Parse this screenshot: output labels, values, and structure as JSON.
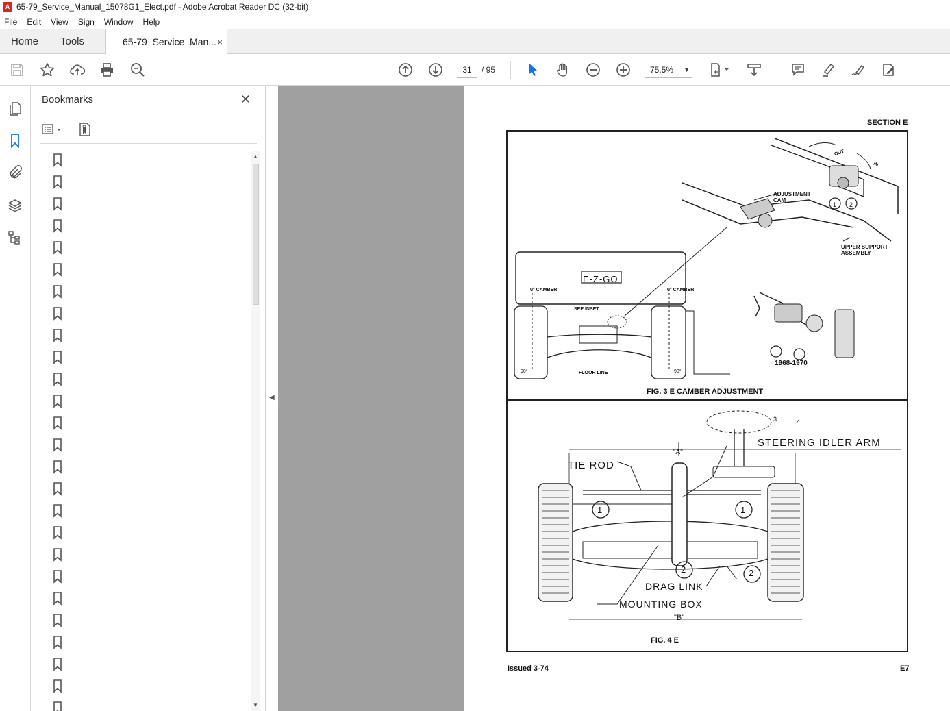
{
  "window": {
    "title": "65-79_Service_Manual_15078G1_Elect.pdf - Adobe Acrobat Reader DC (32-bit)"
  },
  "menu": [
    "File",
    "Edit",
    "View",
    "Sign",
    "Window",
    "Help"
  ],
  "tabs": {
    "home": "Home",
    "tools": "Tools",
    "document": "65-79_Service_Man...",
    "close": "×"
  },
  "toolbar": {
    "page_current": "31",
    "page_total": "/ 95",
    "zoom": "75.5%",
    "icons": [
      "save-icon",
      "star-icon",
      "upload-icon",
      "print-icon",
      "zoom-search-icon",
      "prev-page-icon",
      "next-page-icon",
      "select-cursor-icon",
      "hand-icon",
      "zoom-out-icon",
      "zoom-in-icon",
      "fit-page-icon",
      "scroll-mode-icon",
      "comment-icon",
      "highlight-icon",
      "sign-icon",
      "more-tools-icon"
    ]
  },
  "rail": {
    "icons": [
      "pages-icon",
      "bookmark-icon",
      "attachment-icon",
      "layers-icon",
      "tags-icon"
    ]
  },
  "bookmarks": {
    "title": "Bookmarks",
    "close": "✕",
    "count": 26
  },
  "document": {
    "section": "SECTION E",
    "fig3": {
      "caption": "FIG. 3 E CAMBER ADJUSTMENT",
      "adjustment_cam": "ADJUSTMENT CAM",
      "upper_support": "UPPER SUPPORT ASSEMBLY",
      "out": "OUT",
      "in": "IN",
      "brand": "E-Z-GO",
      "camber_left": "0° CAMBER",
      "camber_right": "0° CAMBER",
      "see_inset": "SEE INSET",
      "floor_line": "FLOOR LINE",
      "angle_left": "90°",
      "angle_right": "90°",
      "years": "1968-1970",
      "callouts": [
        "1",
        "2",
        "3",
        "4"
      ]
    },
    "fig4": {
      "caption": "FIG. 4 E",
      "steering_idler_arm": "STEERING  IDLER  ARM",
      "tie_rod": "TIE ROD",
      "drag_link": "DRAG  LINK",
      "mounting_box": "MOUNTING  BOX",
      "dim_a": "\"A\"",
      "dim_b": "\"B\"",
      "callouts": [
        "1",
        "1",
        "2",
        "2"
      ]
    },
    "footer_left": "Issued 3-74",
    "footer_right": "E7"
  }
}
